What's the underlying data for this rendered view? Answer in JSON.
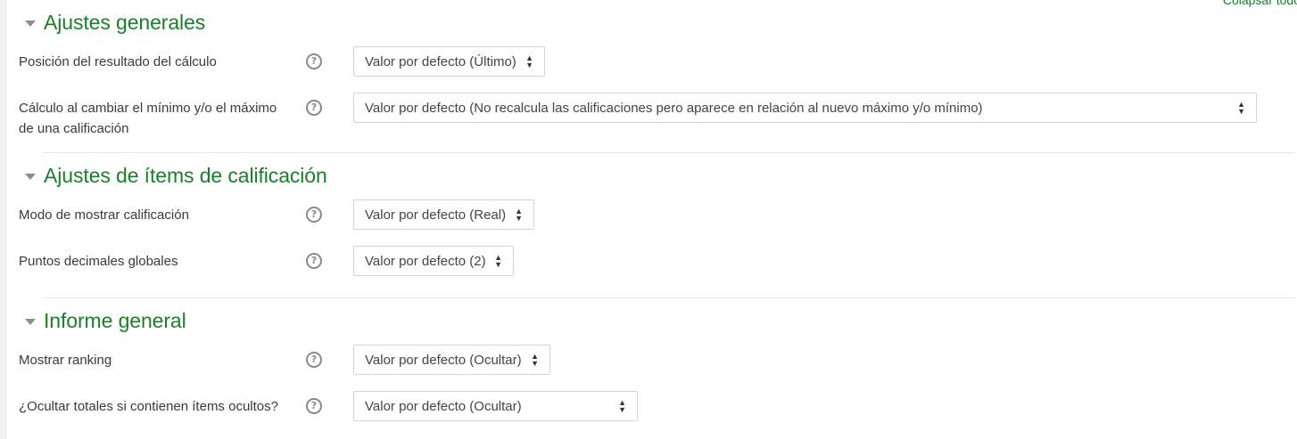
{
  "top_right": {
    "collapse_link": "Colapsar todo"
  },
  "sections": [
    {
      "title": "Ajustes generales",
      "rows": [
        {
          "label": "Posición del resultado del cálculo",
          "value": "Valor por defecto (Último)"
        },
        {
          "label": "Cálculo al cambiar el mínimo y/o el máximo de una calificación",
          "value": "Valor por defecto (No recalcula las calificaciones pero aparece en relación al nuevo máximo y/o mínimo)"
        }
      ]
    },
    {
      "title": "Ajustes de ítems de calificación",
      "rows": [
        {
          "label": "Modo de mostrar calificación",
          "value": "Valor por defecto (Real)"
        },
        {
          "label": "Puntos decimales globales",
          "value": "Valor por defecto (2)"
        }
      ]
    },
    {
      "title": "Informe general",
      "rows": [
        {
          "label": "Mostrar ranking",
          "value": "Valor por defecto (Ocultar)"
        },
        {
          "label": "¿Ocultar totales si contienen ítems ocultos?",
          "value": "Valor por defecto (Ocultar)"
        }
      ]
    }
  ],
  "icons": {
    "help": "question-circle-icon",
    "caret": "caret-down-icon",
    "select_arrows": "up-down-arrows-icon"
  },
  "colors": {
    "accent": "#1a7f2b",
    "text": "#373a3c",
    "border": "#d4d4d4"
  }
}
